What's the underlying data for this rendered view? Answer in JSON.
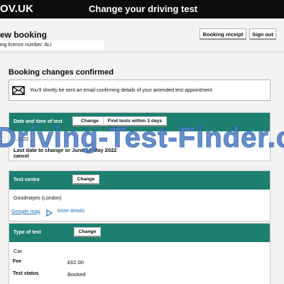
{
  "header": {
    "logo": "OV.UK",
    "service_name": "Change your driving test"
  },
  "subheader": {
    "title": "ew booking",
    "licence": "ing licence number: ALI",
    "receipt_label": "Booking receipt",
    "signout_label": "Sign out"
  },
  "confirmation": {
    "heading": "Booking changes confirmed",
    "email_text": "You'll shortly be sent an email confirming details of your amended test appointment",
    "icon": "envelope-icon"
  },
  "date_card": {
    "label": "Date and time of test",
    "change_label": "Change",
    "find_label": "Find tests within 3 days",
    "datetime": "...2022",
    "last_date": "Last date to change or June 10 May 2022",
    "cancel": "cancel"
  },
  "centre_card": {
    "label": "Test centre",
    "change_label": "Change",
    "centre_name": "Goodmayes (London)",
    "map_link": "Google map",
    "more_details": "More details",
    "icon": "play-icon"
  },
  "type_card": {
    "label": "Type of test",
    "change_label": "Change",
    "vehicle": "Car",
    "fee_label": "Fee",
    "fee_value": "£62.00",
    "status_label": "Test status",
    "status_value": "Booked"
  },
  "watermark": "Driving-Test-Finder.c",
  "colors": {
    "header_bg": "#0b0c0c",
    "card_head": "#1d7f70",
    "link": "#1d70b8",
    "page_bg": "#f3f2f1"
  }
}
